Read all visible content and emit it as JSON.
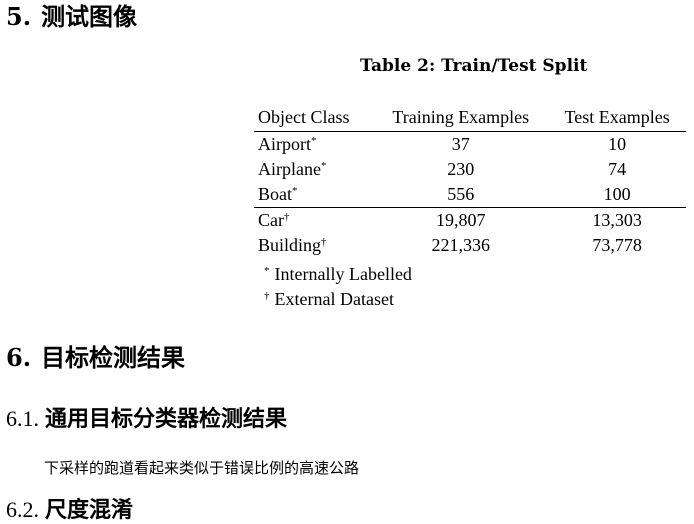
{
  "section5": {
    "number": "5.",
    "title": "测试图像"
  },
  "table": {
    "caption": "Table 2: Train/Test Split",
    "headers": [
      "Object Class",
      "Training Examples",
      "Test Examples"
    ],
    "rows": [
      {
        "cls": "Airport",
        "mark": "*",
        "train": "37",
        "test": "10"
      },
      {
        "cls": "Airplane",
        "mark": "*",
        "train": "230",
        "test": "74"
      },
      {
        "cls": "Boat",
        "mark": "*",
        "train": "556",
        "test": "100"
      },
      {
        "cls": "Car",
        "mark": "†",
        "train": "19,807",
        "test": "13,303"
      },
      {
        "cls": "Building",
        "mark": "†",
        "train": "221,336",
        "test": "73,778"
      }
    ],
    "notes": [
      {
        "mark": "*",
        "text": "Internally Labelled"
      },
      {
        "mark": "†",
        "text": "External Dataset"
      }
    ]
  },
  "section6": {
    "number": "6.",
    "title": "目标检测结果"
  },
  "section61": {
    "number": "6.1.",
    "title": "通用目标分类器检测结果",
    "paragraph": "下采样的跑道看起来类似于错误比例的高速公路"
  },
  "section62": {
    "number": "6.2.",
    "title": "尺度混淆"
  }
}
